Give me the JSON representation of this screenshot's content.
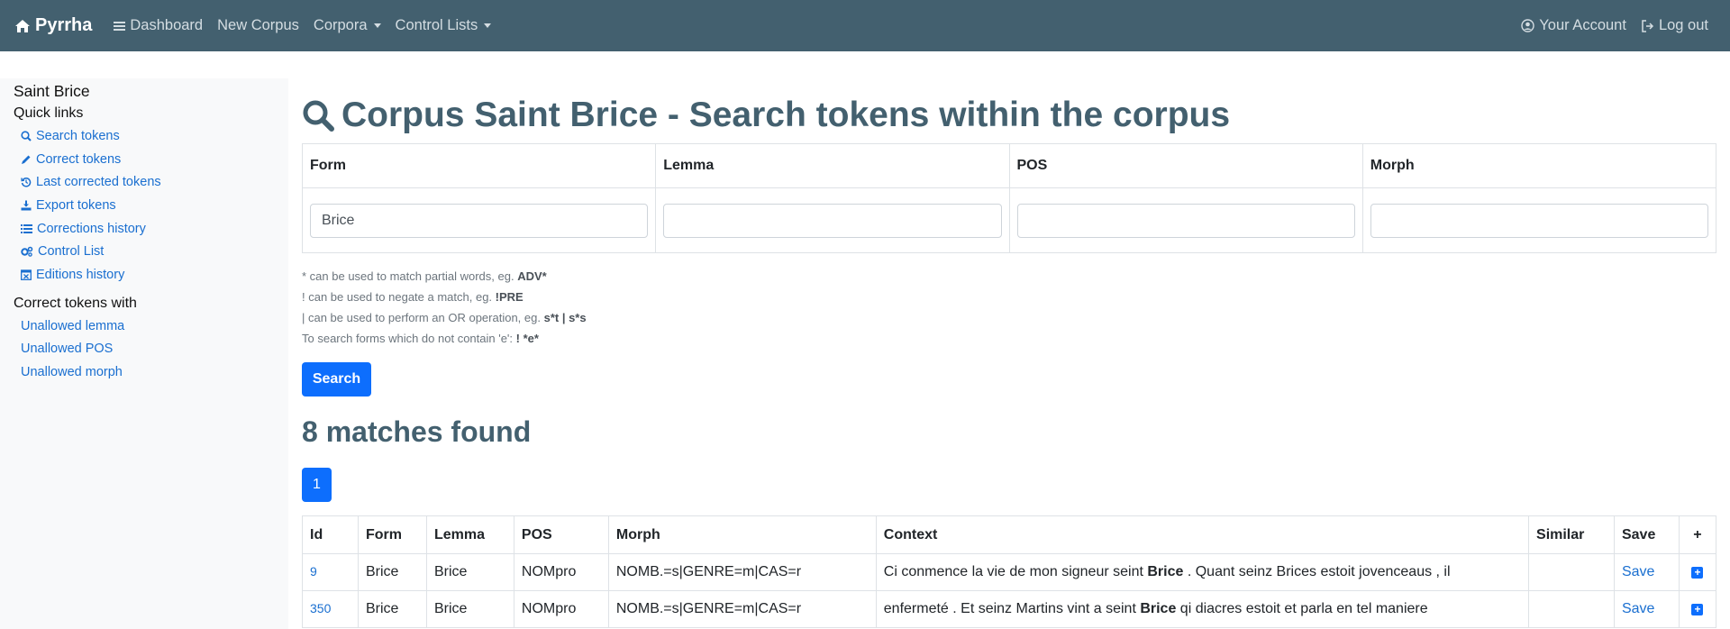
{
  "navbar": {
    "brand": "Pyrrha",
    "items": [
      {
        "label": "Dashboard"
      },
      {
        "label": "New Corpus"
      },
      {
        "label": "Corpora"
      },
      {
        "label": "Control Lists"
      }
    ],
    "account": "Your Account",
    "logout": "Log out"
  },
  "sidebar": {
    "corpus_name": "Saint Brice",
    "quick_links_title": "Quick links",
    "links": [
      {
        "label": "Search tokens",
        "icon": "search-icon"
      },
      {
        "label": "Correct tokens",
        "icon": "pencil-icon"
      },
      {
        "label": "Last corrected tokens",
        "icon": "history-icon"
      },
      {
        "label": "Export tokens",
        "icon": "download-icon"
      },
      {
        "label": "Corrections history",
        "icon": "list-icon"
      },
      {
        "label": "Control List",
        "icon": "gears-icon"
      },
      {
        "label": "Editions history",
        "icon": "calendar-icon"
      }
    ],
    "correct_with_title": "Correct tokens with",
    "correct_links": [
      {
        "label": "Unallowed lemma"
      },
      {
        "label": "Unallowed POS"
      },
      {
        "label": "Unallowed morph"
      }
    ]
  },
  "main": {
    "title": "Corpus Saint Brice - Search tokens within the corpus",
    "search_headers": [
      "Form",
      "Lemma",
      "POS",
      "Morph"
    ],
    "search_values": {
      "form": "Brice",
      "lemma": "",
      "pos": "",
      "morph": ""
    },
    "hints": [
      {
        "text": "* can be used to match partial words, eg. ",
        "example": "ADV*"
      },
      {
        "text": "! can be used to negate a match, eg. ",
        "example": "!PRE"
      },
      {
        "text": "| can be used to perform an OR operation, eg. ",
        "example": "s*t | s*s"
      },
      {
        "text": "To search forms which do not contain 'e': ",
        "example": "! *e*"
      }
    ],
    "search_button": "Search",
    "matches_text": "8 matches found",
    "current_page": "1",
    "result_headers": [
      "Id",
      "Form",
      "Lemma",
      "POS",
      "Morph",
      "Context",
      "Similar",
      "Save",
      "+"
    ],
    "rows": [
      {
        "id": "9",
        "form": "Brice",
        "lemma": "Brice",
        "pos": "NOMpro",
        "morph": "NOMB.=s|GENRE=m|CAS=r",
        "ctx_before": "Ci conmence la vie de mon signeur seint ",
        "ctx_token": "Brice",
        "ctx_after": " . Quant seinz Brices estoit jovenceaus , il",
        "similar": "",
        "save": "Save"
      },
      {
        "id": "350",
        "form": "Brice",
        "lemma": "Brice",
        "pos": "NOMpro",
        "morph": "NOMB.=s|GENRE=m|CAS=r",
        "ctx_before": "enfermeté . Et seinz Martins vint a seint ",
        "ctx_token": "Brice",
        "ctx_after": " qi diacres estoit et parla en tel maniere",
        "similar": "",
        "save": "Save"
      }
    ]
  },
  "colors": {
    "navbar": "#43606f",
    "primary": "#0d6efd",
    "link": "#1a6fd0",
    "heading": "#43606f"
  }
}
